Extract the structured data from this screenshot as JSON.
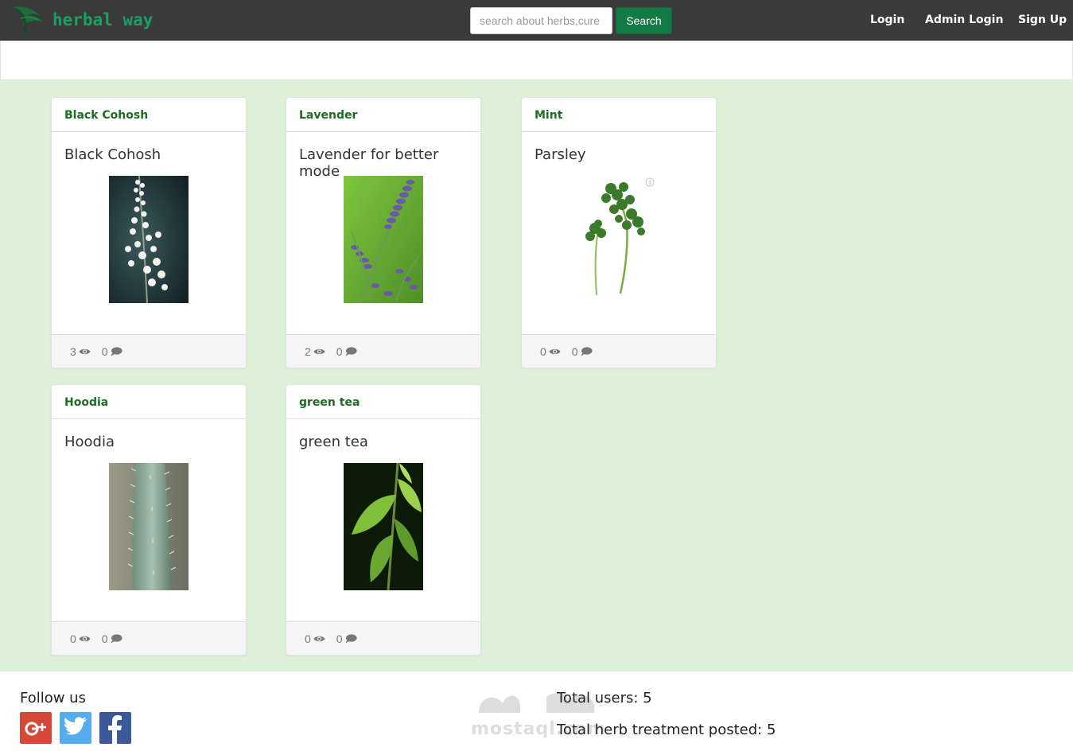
{
  "brand": {
    "name": "herbal  way",
    "logo_icon": "leaf-icon"
  },
  "search": {
    "placeholder": "search about herbs,cure",
    "button_label": "Search"
  },
  "nav": {
    "login": "Login",
    "admin_login": "Admin Login",
    "sign_up": "Sign Up"
  },
  "cards": [
    {
      "title": "Black Cohosh",
      "subtitle": "Black Cohosh",
      "image": "black-cohosh-image",
      "views": "3",
      "comments": "0"
    },
    {
      "title": "Lavender",
      "subtitle": "Lavender for better mode",
      "image": "lavender-image",
      "views": "2",
      "comments": "0"
    },
    {
      "title": "Mint",
      "subtitle": "Parsley",
      "image": "parsley-image",
      "views": "0",
      "comments": "0"
    },
    {
      "title": "Hoodia",
      "subtitle": "Hoodia",
      "image": "hoodia-image",
      "views": "0",
      "comments": "0"
    },
    {
      "title": "green tea",
      "subtitle": "green tea",
      "image": "green-tea-image",
      "views": "0",
      "comments": "0"
    }
  ],
  "footer": {
    "follow_label": "Follow us",
    "social": [
      "google-plus-icon",
      "twitter-icon",
      "facebook-icon"
    ],
    "total_users": "Total users: 5",
    "total_posts": "Total herb treatment posted: 5",
    "watermark": "mostaql.com"
  },
  "colors": {
    "navbar": "#3a3a3a",
    "brand": "#1aa061",
    "search_button": "#137a46",
    "main_bg": "#dff0d8",
    "card_title": "#1b6e1f"
  }
}
